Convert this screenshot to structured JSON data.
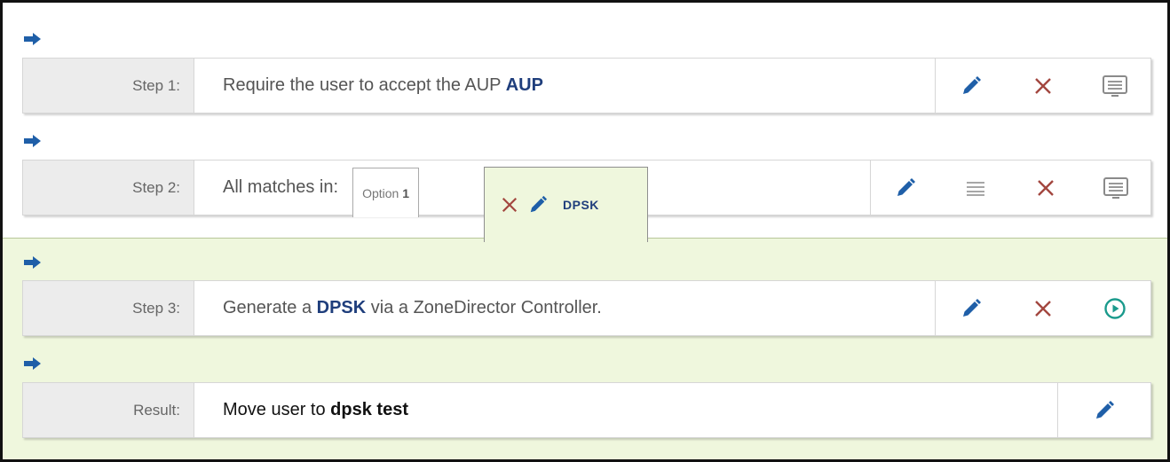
{
  "steps": [
    {
      "label": "Step 1:",
      "desc_pre": "Require the user to accept the AUP ",
      "desc_bold": "AUP",
      "desc_post": "",
      "actions": [
        "edit-icon",
        "delete-icon",
        "screen-icon"
      ]
    },
    {
      "label": "Step 2:",
      "desc_pre": "All matches in:",
      "option_tab_text": "Option ",
      "option_tab_num": "1",
      "active_tab_name": "DPSK",
      "add_tab": "+",
      "actions": [
        "edit-icon",
        "menu-icon",
        "delete-icon",
        "screen-icon"
      ]
    },
    {
      "label": "Step 3:",
      "desc_pre": "Generate a ",
      "desc_bold": "DPSK",
      "desc_post": " via a ZoneDirector Controller.",
      "actions": [
        "edit-icon",
        "delete-icon",
        "play-circle-icon"
      ]
    }
  ],
  "result": {
    "label": "Result:",
    "desc_pre": "Move user to ",
    "desc_bold": "dpsk test",
    "actions": [
      "edit-icon"
    ]
  },
  "colors": {
    "accent_blue": "#1f5fa8",
    "delete_red": "#a3473f",
    "play_teal": "#1a9a8c",
    "screen_gray": "#8a8a8a",
    "green_zone": "#eff7dd"
  }
}
